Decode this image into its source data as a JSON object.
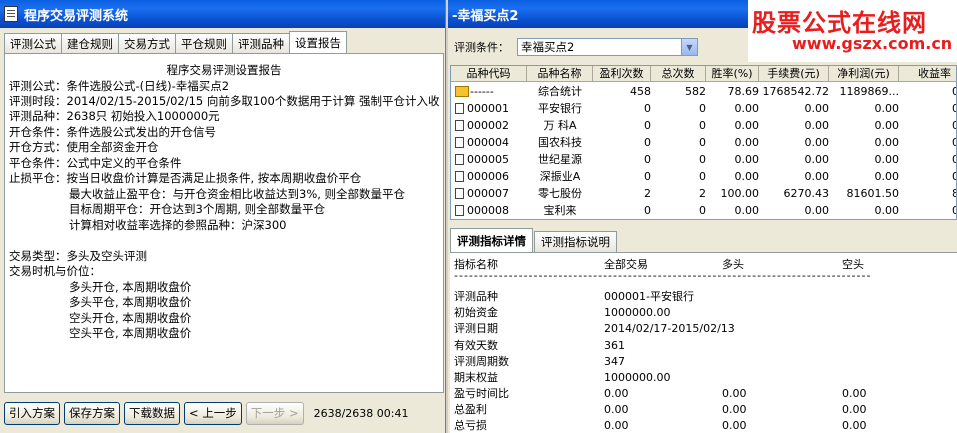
{
  "left": {
    "title": "程序交易评测系统",
    "tabs": [
      "评测公式",
      "建仓规则",
      "交易方式",
      "平仓规则",
      "评测品种",
      "设置报告"
    ],
    "active_tab": 5,
    "report_title": "程序交易评测设置报告",
    "lines": [
      "评测公式：条件选股公式-(日线)-幸福买点2",
      "评测时段：2014/02/15-2015/02/15 向前多取100个数据用于计算 强制平仓计入收",
      "评测品种：2638只 初始投入1000000元",
      "开仓条件：条件选股公式发出的开仓信号",
      "开仓方式：使用全部资金开仓",
      "平仓条件：公式中定义的平仓条件",
      "止损平仓：按当日收盘价计算是否满足止损条件, 按本周期收盘价平仓",
      "最大收益止盈平仓：与开仓资金相比收益达到3%, 则全部数量平仓",
      "目标周期平仓：开仓达到3个周期, 则全部数量平仓",
      "计算相对收益率选择的参照品种：沪深300",
      "交易类型：多头及空头评测",
      "交易时机与价位：",
      "多头开仓, 本周期收盘价",
      "多头平仓, 本周期收盘价",
      "空头开仓, 本周期收盘价",
      "空头平仓, 本周期收盘价"
    ],
    "buttons": [
      "引入方案",
      "保存方案",
      "下载数据",
      "< 上一步",
      "下一步 >"
    ],
    "status": "2638/2638 00:41"
  },
  "right": {
    "title": "-幸福买点2",
    "condition_label": "评测条件：",
    "condition_value": "幸福买点2",
    "columns": [
      "品种代码",
      "品种名称",
      "盈利次数",
      "总次数",
      "胜率(%)",
      "手续费(元)",
      "净利润(元)",
      "收益率"
    ],
    "rows": [
      [
        "------",
        "综合统计",
        "458",
        "582",
        "78.69",
        "1768542.72",
        "1189869...",
        "0"
      ],
      [
        "000001",
        "平安银行",
        "0",
        "0",
        "0.00",
        "0.00",
        "0.00",
        "0"
      ],
      [
        "000002",
        "万 科A",
        "0",
        "0",
        "0.00",
        "0.00",
        "0.00",
        "0"
      ],
      [
        "000004",
        "国农科技",
        "0",
        "0",
        "0.00",
        "0.00",
        "0.00",
        "0"
      ],
      [
        "000005",
        "世纪星源",
        "0",
        "0",
        "0.00",
        "0.00",
        "0.00",
        "0"
      ],
      [
        "000006",
        "深振业A",
        "0",
        "0",
        "0.00",
        "0.00",
        "0.00",
        "0"
      ],
      [
        "000007",
        "零七股份",
        "2",
        "2",
        "100.00",
        "6270.43",
        "81601.50",
        "8"
      ],
      [
        "000008",
        "宝利来",
        "0",
        "0",
        "0.00",
        "0.00",
        "0.00",
        "0"
      ]
    ],
    "detail_tabs": [
      "评测指标详情",
      "评测指标说明"
    ],
    "detail_header": [
      "指标名称",
      "全部交易",
      "多头",
      "空头"
    ],
    "dash_line": "------------------------------------------------------------------------------------",
    "detail_rows": [
      [
        "评测品种",
        "000001-平安银行",
        "",
        ""
      ],
      [
        "初始资金",
        "1000000.00",
        "",
        ""
      ],
      [
        "评测日期",
        "2014/02/17-2015/02/13",
        "",
        ""
      ],
      [
        "有效天数",
        "361",
        "",
        ""
      ],
      [
        "评测周期数",
        "347",
        "",
        ""
      ],
      [
        "期末权益",
        "1000000.00",
        "",
        ""
      ],
      [
        "盈亏时间比",
        "0.00",
        "0.00",
        "0.00"
      ],
      [
        "总盈利",
        "0.00",
        "0.00",
        "0.00"
      ],
      [
        "总亏损",
        "0.00",
        "0.00",
        "0.00"
      ]
    ]
  },
  "watermark": {
    "line1": "股票公式在线网",
    "line2": "www.gszx.com.cn"
  }
}
